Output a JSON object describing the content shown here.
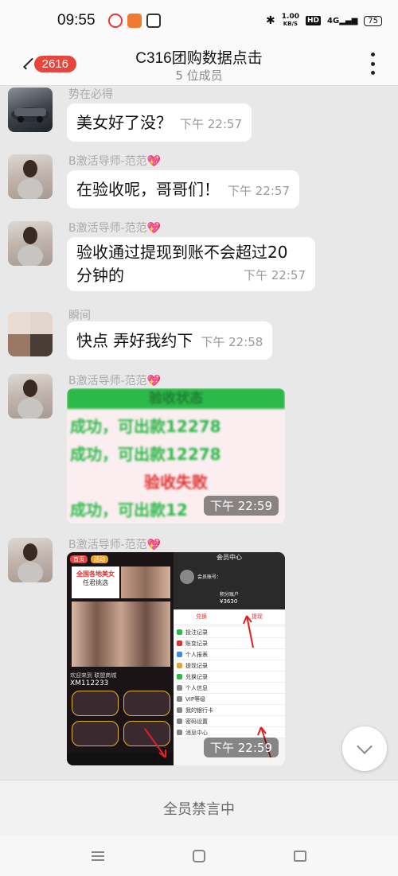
{
  "status_bar": {
    "time": "09:55",
    "net_speed_value": "1.00",
    "net_speed_unit": "KB/S",
    "hd_label": "HD",
    "network": "4G",
    "battery": "75"
  },
  "header": {
    "unread_count": "2616",
    "title": "C316团购数据点击",
    "subtitle": "5 位成员"
  },
  "messages": [
    {
      "sender": "势在必得",
      "text": "美女好了没？",
      "time": "下午 22:57"
    },
    {
      "sender": "B激活导师-范范💖",
      "text": "在验收呢，哥哥们！",
      "time": "下午 22:57"
    },
    {
      "sender": "B激活导师-范范💖",
      "text_line1": "验收通过提现到账不会超过20",
      "text_line2": "分钟的",
      "time": "下午 22:57"
    },
    {
      "sender": "瞬间",
      "text": "快点 弄好我约下",
      "time": "下午 22:58"
    },
    {
      "sender": "B激活导师-范范💖",
      "time": "下午 22:59",
      "image": {
        "header": "验收状态",
        "line1": "成功，可出款12278",
        "line2": "成功，可出款12278",
        "line3": "验收失败",
        "line4": "成功，可出款12"
      }
    },
    {
      "sender": "B激活导师-范范💖",
      "time": "下午 22:59",
      "image": {
        "left_banner": "全国各地美女",
        "left_banner_sub": "任君挑选",
        "left_tab1": "首页",
        "left_tab2": "活动",
        "left_welcome": "欢迎来到 联盟商城",
        "left_user": "XM112233",
        "right_title": "会员中心",
        "right_account": "会员账号：",
        "right_points_label": "积分账户",
        "right_points": "¥3630",
        "right_exchange": "兑换",
        "right_withdraw": "提现",
        "right_menu": [
          "投注记录",
          "账变记录",
          "个人报表",
          "提现记录",
          "兑换记录",
          "个人信息",
          "VIP等级",
          "我的银行卡",
          "密码设置",
          "消息中心"
        ]
      }
    }
  ],
  "footer": {
    "muted_text": "全员禁言中"
  },
  "colors": {
    "badge": "#e8453c",
    "bubble": "#ffffff",
    "chat_bg": "#e8e8e8",
    "green_text": "#2db84a",
    "red_text": "#e03030"
  }
}
